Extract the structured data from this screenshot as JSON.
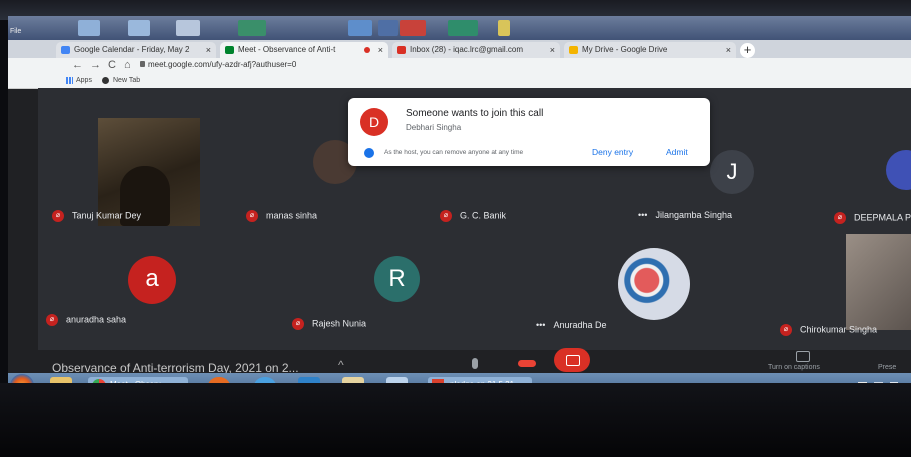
{
  "old_window": {
    "file_label": "File"
  },
  "browser": {
    "tabs": [
      {
        "label": "Google Calendar - Friday, May 2",
        "icon_color": "#4285f4"
      },
      {
        "label": "Meet - Observance of Anti-t",
        "icon_color": "#00832d"
      },
      {
        "label": "Inbox (28) - iqac.lrc@gmail.com",
        "icon_color": "#d93025"
      },
      {
        "label": "My Drive - Google Drive",
        "icon_color": "#f4b400"
      }
    ],
    "url": "meet.google.com/ufy-azdr-afj?authuser=0",
    "bookmarks": {
      "apps": "Apps",
      "new_tab": "New Tab"
    }
  },
  "participants": [
    {
      "name": "Tanuj Kumar Dey",
      "initial": "",
      "muted": true
    },
    {
      "name": "manas sinha",
      "initial": "",
      "muted": true
    },
    {
      "name": "G. C. Banik",
      "initial": "",
      "muted": true
    },
    {
      "name": "Jilangamba Singha",
      "initial": "J",
      "muted": false
    },
    {
      "name": "DEEPMALA P",
      "initial": "",
      "muted": true
    },
    {
      "name": "anuradha saha",
      "initial": "a",
      "muted": true
    },
    {
      "name": "Rajesh Nunia",
      "initial": "R",
      "muted": true
    },
    {
      "name": "Anuradha De",
      "initial": "",
      "muted": false
    },
    {
      "name": "Chirokumar Singha",
      "initial": "",
      "muted": true
    }
  ],
  "join_request": {
    "avatar_initial": "D",
    "title": "Someone wants to join this call",
    "requester": "Debhari Singha",
    "host_note": "As the host, you can remove anyone at any time",
    "deny_label": "Deny entry",
    "admit_label": "Admit"
  },
  "meeting_bar": {
    "title": "Observance of Anti-terrorism Day, 2021 on 2...",
    "captions_label": "Turn on captions",
    "present_label": "Prese"
  },
  "taskbar": {
    "meet_button": "Meet - Observ",
    "pledge_button": "pledge on 21.5.21"
  },
  "colors": {
    "accent_red": "#d93025",
    "avatar_red": "#c5221f",
    "avatar_teal": "#2b6f6b",
    "admit_blue": "#1a73e8"
  }
}
